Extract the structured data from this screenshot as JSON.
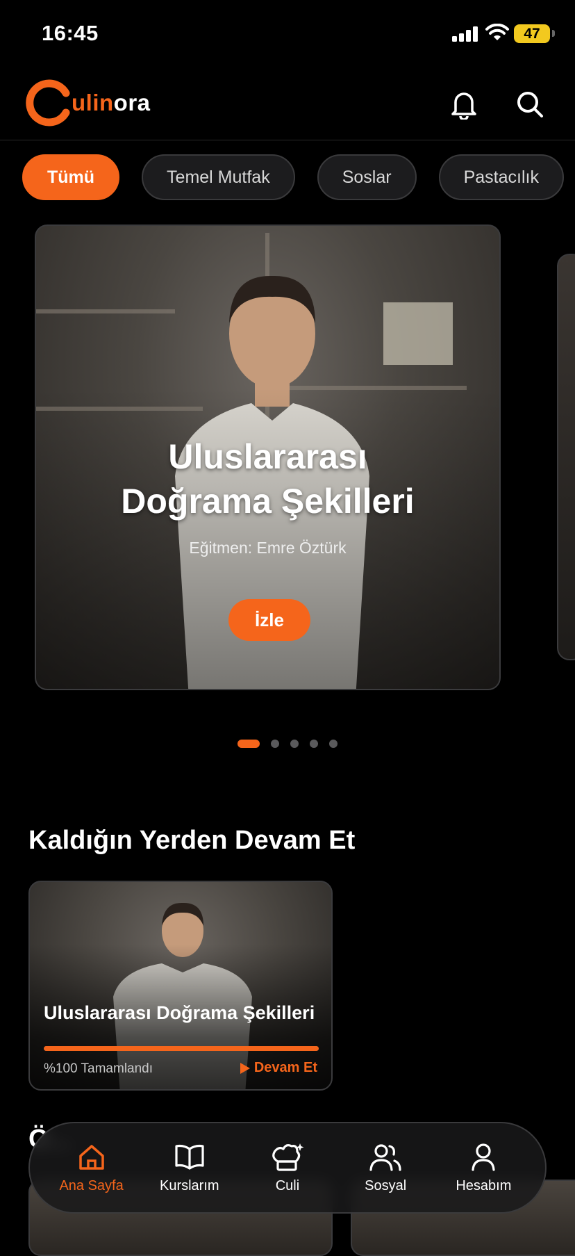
{
  "status": {
    "time": "16:45",
    "battery": "47"
  },
  "header": {
    "logo_text_1": "ulin",
    "logo_text_2": "ora"
  },
  "filters": [
    "Tümü",
    "Temel Mutfak",
    "Soslar",
    "Pastacılık"
  ],
  "hero": {
    "title_line1": "Uluslararası",
    "title_line2": "Doğrama Şekilleri",
    "instructor": "Eğitmen: Emre Öztürk",
    "watch_label": "İzle"
  },
  "pagination": {
    "total": 5,
    "active": 0
  },
  "continue": {
    "section_title": "Kaldığın Yerden Devam Et",
    "course_title": "Uluslararası  Doğrama Şekilleri",
    "progress": 1.0,
    "status": "%100 Tamamlandı",
    "resume_label": "Devam Et"
  },
  "next_section": {
    "title": "Ö..."
  },
  "tabbar": {
    "items": [
      {
        "label": "Ana Sayfa",
        "icon": "home-icon",
        "active": true
      },
      {
        "label": "Kurslarım",
        "icon": "book-icon",
        "active": false
      },
      {
        "label": "Culi",
        "icon": "chef-hat-icon",
        "active": false
      },
      {
        "label": "Sosyal",
        "icon": "users-icon",
        "active": false
      },
      {
        "label": "Hesabım",
        "icon": "user-icon",
        "active": false
      }
    ]
  },
  "colors": {
    "accent": "#f5651b",
    "background": "#000000"
  }
}
